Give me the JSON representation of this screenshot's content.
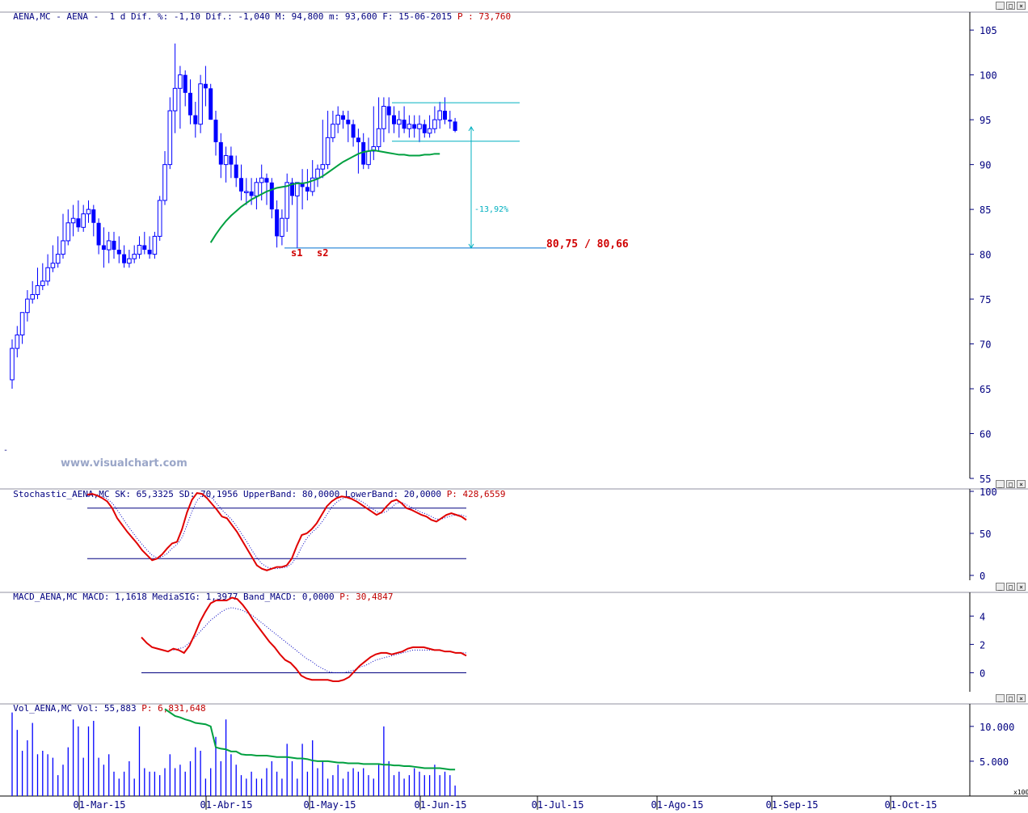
{
  "price_panel": {
    "header_symbol": "AENA,MC - AENA -  1 d Dif. %: -1,10 Dif.: -1,040 M: 94,800 m: 93,600 F: 15-06-2015",
    "header_p_label": "P : 73,760",
    "watermark": "www.visualchart.com",
    "support_label": "80,75 / 80,66",
    "s1_label": "s1",
    "s2_label": "s2",
    "pct_label": "-13,92%"
  },
  "stoch_panel": {
    "header": "Stochastic_AENA,MC SK: 65,3325 SD: 70,1956 UpperBand: 80,0000 LowerBand: 20,0000",
    "header_p": "P: 428,6559"
  },
  "macd_panel": {
    "header": "MACD_AENA,MC MACD: 1,1618 MediaSIG: 1,3977 Band_MACD: 0,0000",
    "header_p": "P: 30,4847"
  },
  "vol_panel": {
    "header": "Vol_AENA,MC Vol: 55,883",
    "header_p": "P: 6,831,648",
    "multiplier": "x100"
  },
  "colors": {
    "candle": "#0000ff",
    "ma": "#00a040",
    "osc_main": "#e00000",
    "osc_signal": "#0000c0",
    "band": "#000080",
    "annot": "#00b0c0",
    "support": "#0070d0",
    "label_red": "#d00000"
  },
  "chart_data": [
    {
      "type": "candlestick",
      "title": "AENA,MC - AENA - 1 d",
      "x": [
        "11-Feb-15",
        "12-Feb-15",
        "13-Feb-15",
        "16-Feb-15",
        "17-Feb-15",
        "18-Feb-15",
        "19-Feb-15",
        "20-Feb-15",
        "23-Feb-15",
        "24-Feb-15",
        "25-Feb-15",
        "26-Feb-15",
        "27-Feb-15",
        "02-Mar-15",
        "03-Mar-15",
        "04-Mar-15",
        "05-Mar-15",
        "06-Mar-15",
        "09-Mar-15",
        "10-Mar-15",
        "11-Mar-15",
        "12-Mar-15",
        "13-Mar-15",
        "16-Mar-15",
        "17-Mar-15",
        "18-Mar-15",
        "19-Mar-15",
        "20-Mar-15",
        "23-Mar-15",
        "24-Mar-15",
        "25-Mar-15",
        "26-Mar-15",
        "27-Mar-15",
        "30-Mar-15",
        "31-Mar-15",
        "01-Apr-15",
        "02-Apr-15",
        "06-Apr-15",
        "07-Apr-15",
        "08-Apr-15",
        "09-Apr-15",
        "10-Apr-15",
        "13-Apr-15",
        "14-Apr-15",
        "15-Apr-15",
        "16-Apr-15",
        "17-Apr-15",
        "20-Apr-15",
        "21-Apr-15",
        "22-Apr-15",
        "23-Apr-15",
        "24-Apr-15",
        "27-Apr-15",
        "28-Apr-15",
        "29-Apr-15",
        "30-Apr-15",
        "01-May-15",
        "04-May-15",
        "05-May-15",
        "06-May-15",
        "07-May-15",
        "08-May-15",
        "11-May-15",
        "12-May-15",
        "13-May-15",
        "14-May-15",
        "15-May-15",
        "18-May-15",
        "19-May-15",
        "20-May-15",
        "21-May-15",
        "22-May-15",
        "25-May-15",
        "26-May-15",
        "27-May-15",
        "28-May-15",
        "29-May-15",
        "01-Jun-15",
        "02-Jun-15",
        "03-Jun-15",
        "04-Jun-15",
        "05-Jun-15",
        "08-Jun-15",
        "09-Jun-15",
        "10-Jun-15",
        "11-Jun-15",
        "12-Jun-15",
        "15-Jun-15"
      ],
      "open": [
        66.0,
        69.5,
        71.0,
        73.5,
        75.0,
        75.5,
        76.5,
        77.0,
        78.5,
        79.0,
        80.0,
        81.5,
        83.5,
        84.0,
        83.0,
        84.5,
        85.0,
        83.5,
        81.0,
        80.5,
        81.5,
        80.5,
        80.0,
        79.0,
        79.5,
        80.0,
        81.0,
        80.5,
        80.0,
        82.0,
        86.0,
        90.0,
        96.0,
        98.5,
        100.0,
        98.0,
        95.5,
        94.5,
        99.0,
        98.5,
        95.0,
        92.5,
        90.0,
        91.0,
        90.0,
        88.5,
        87.0,
        87.0,
        86.5,
        88.0,
        88.5,
        88.0,
        85.0,
        82.0,
        84.0,
        88.0,
        86.5,
        88.0,
        87.5,
        87.0,
        88.5,
        89.5,
        90.0,
        93.0,
        94.5,
        95.5,
        95.0,
        94.5,
        93.0,
        92.5,
        90.0,
        91.5,
        92.0,
        94.0,
        96.5,
        95.5,
        94.5,
        95.0,
        94.0,
        94.5,
        94.0,
        94.5,
        93.5,
        94.0,
        95.0,
        96.0,
        95.0,
        94.8
      ],
      "high": [
        70.5,
        72.0,
        73.5,
        76.0,
        77.0,
        78.5,
        79.0,
        80.0,
        81.0,
        82.0,
        84.5,
        85.0,
        85.5,
        86.0,
        85.5,
        86.0,
        85.5,
        84.0,
        83.0,
        82.5,
        82.5,
        82.0,
        81.0,
        80.5,
        81.0,
        82.0,
        82.5,
        82.0,
        82.5,
        86.5,
        91.5,
        97.5,
        103.5,
        101.0,
        100.5,
        99.5,
        97.0,
        100.0,
        101.0,
        99.0,
        96.0,
        93.5,
        92.0,
        92.0,
        91.0,
        90.0,
        88.5,
        88.5,
        88.5,
        90.0,
        89.0,
        88.5,
        86.0,
        85.0,
        89.0,
        88.5,
        88.0,
        89.5,
        89.5,
        90.5,
        90.0,
        95.0,
        96.0,
        96.0,
        96.5,
        96.0,
        96.0,
        95.0,
        94.0,
        93.5,
        93.0,
        96.5,
        97.5,
        97.5,
        97.5,
        96.5,
        96.0,
        96.5,
        95.5,
        95.5,
        95.5,
        95.0,
        95.5,
        96.5,
        97.0,
        97.5,
        96.0,
        95.2
      ],
      "low": [
        65.0,
        68.5,
        70.0,
        72.5,
        74.5,
        75.0,
        76.0,
        76.5,
        78.0,
        78.5,
        79.5,
        81.0,
        82.0,
        82.5,
        82.5,
        83.5,
        82.0,
        80.0,
        78.5,
        79.0,
        79.5,
        79.0,
        78.5,
        78.5,
        79.0,
        79.5,
        80.0,
        79.5,
        79.5,
        81.5,
        85.5,
        89.5,
        93.5,
        94.0,
        96.5,
        94.5,
        93.0,
        93.5,
        96.5,
        95.0,
        91.0,
        88.5,
        88.0,
        88.5,
        87.5,
        86.0,
        85.5,
        85.5,
        85.0,
        86.0,
        85.5,
        84.0,
        80.75,
        81.0,
        82.5,
        85.5,
        80.66,
        85.0,
        86.0,
        86.5,
        87.5,
        88.5,
        89.5,
        92.5,
        93.5,
        94.0,
        92.5,
        92.0,
        89.0,
        89.5,
        89.5,
        90.5,
        91.5,
        92.5,
        93.5,
        93.5,
        93.0,
        93.5,
        93.0,
        93.0,
        92.5,
        93.0,
        93.0,
        93.5,
        94.0,
        94.5,
        94.0,
        93.6
      ],
      "close": [
        69.5,
        71.0,
        73.5,
        75.0,
        75.5,
        76.5,
        77.0,
        78.5,
        79.0,
        80.0,
        81.5,
        83.5,
        84.0,
        83.0,
        84.5,
        85.0,
        83.5,
        81.0,
        80.5,
        81.5,
        80.5,
        80.0,
        79.0,
        79.5,
        80.0,
        81.0,
        80.5,
        80.0,
        82.0,
        86.0,
        90.0,
        96.0,
        98.5,
        100.0,
        98.0,
        95.5,
        94.5,
        99.0,
        98.5,
        95.0,
        92.5,
        90.0,
        91.0,
        90.0,
        88.5,
        87.0,
        87.0,
        86.5,
        88.0,
        88.5,
        88.0,
        85.0,
        82.0,
        84.0,
        88.0,
        86.5,
        88.0,
        87.5,
        87.0,
        88.5,
        89.5,
        90.0,
        93.0,
        94.5,
        95.5,
        95.0,
        94.5,
        93.0,
        92.5,
        90.0,
        91.5,
        92.0,
        94.0,
        96.5,
        95.5,
        94.5,
        95.0,
        94.0,
        94.5,
        94.0,
        94.5,
        93.5,
        94.0,
        95.0,
        96.0,
        95.0,
        94.8,
        93.76
      ],
      "ma": [
        null,
        null,
        null,
        null,
        null,
        null,
        null,
        null,
        null,
        null,
        null,
        null,
        null,
        null,
        null,
        null,
        null,
        null,
        null,
        null,
        null,
        null,
        null,
        null,
        null,
        null,
        null,
        null,
        null,
        null,
        null,
        null,
        null,
        null,
        null,
        null,
        null,
        null,
        null,
        81.3,
        82.2,
        83.0,
        83.7,
        84.3,
        84.8,
        85.3,
        85.7,
        86.1,
        86.4,
        86.7,
        87.0,
        87.2,
        87.4,
        87.5,
        87.6,
        87.8,
        87.9,
        87.9,
        88.0,
        88.2,
        88.4,
        88.7,
        89.1,
        89.5,
        89.9,
        90.3,
        90.6,
        90.9,
        91.2,
        91.4,
        91.5,
        91.6,
        91.5,
        91.4,
        91.3,
        91.2,
        91.1,
        91.1,
        91.0,
        91.0,
        91.0,
        91.1,
        91.1,
        91.2,
        91.2
      ],
      "ylim": [
        55,
        107
      ],
      "yticks": [
        55,
        60,
        65,
        70,
        75,
        80,
        85,
        90,
        95,
        100,
        105
      ],
      "xtick_labels": [
        "01-Mar-15",
        "01-Abr-15",
        "01-May-15",
        "01-Jun-15",
        "01-Jul-15",
        "01-Ago-15",
        "01-Sep-15",
        "01-Oct-15"
      ],
      "annotations": {
        "range_top": 96.9,
        "range_bottom": 92.6,
        "support": 80.7,
        "arrow_from": 94.2,
        "arrow_to": 80.7,
        "pct": "-13,92%"
      }
    },
    {
      "type": "line",
      "title": "Stochastic_AENA,MC",
      "sk": [
        96,
        97,
        95,
        92,
        88,
        80,
        68,
        60,
        52,
        45,
        38,
        30,
        24,
        18,
        20,
        25,
        32,
        38,
        40,
        55,
        75,
        90,
        98,
        97,
        92,
        85,
        78,
        70,
        68,
        60,
        52,
        42,
        32,
        22,
        12,
        8,
        6,
        8,
        10,
        10,
        12,
        20,
        35,
        48,
        50,
        55,
        62,
        72,
        82,
        88,
        92,
        94,
        93,
        91,
        88,
        84,
        80,
        76,
        72,
        75,
        82,
        88,
        90,
        86,
        80,
        78,
        75,
        72,
        70,
        66,
        64,
        68,
        72,
        74,
        72,
        70,
        66
      ],
      "sd": [
        95,
        96,
        96,
        94,
        91,
        86,
        78,
        69,
        60,
        52,
        44,
        37,
        30,
        24,
        21,
        22,
        26,
        32,
        37,
        45,
        60,
        76,
        89,
        95,
        95,
        92,
        85,
        78,
        72,
        66,
        58,
        49,
        40,
        30,
        21,
        14,
        10,
        8,
        8,
        9,
        10,
        14,
        22,
        34,
        44,
        51,
        56,
        63,
        72,
        81,
        87,
        91,
        93,
        93,
        91,
        88,
        84,
        80,
        76,
        74,
        76,
        81,
        86,
        87,
        84,
        81,
        78,
        75,
        73,
        70,
        67,
        67,
        69,
        71,
        72,
        72,
        70
      ],
      "upper_band": 80,
      "lower_band": 20,
      "yticks": [
        0,
        50,
        100
      ],
      "ylim": [
        0,
        100
      ]
    },
    {
      "type": "line",
      "title": "MACD_AENA,MC",
      "macd": [
        2.5,
        2.1,
        1.8,
        1.7,
        1.6,
        1.5,
        1.7,
        1.6,
        1.4,
        1.9,
        2.7,
        3.6,
        4.3,
        4.9,
        5.1,
        5.1,
        5.1,
        5.3,
        5.2,
        4.8,
        4.3,
        3.7,
        3.2,
        2.7,
        2.2,
        1.8,
        1.3,
        0.9,
        0.7,
        0.3,
        -0.2,
        -0.4,
        -0.5,
        -0.5,
        -0.5,
        -0.5,
        -0.6,
        -0.6,
        -0.5,
        -0.3,
        0.1,
        0.5,
        0.8,
        1.1,
        1.3,
        1.4,
        1.4,
        1.3,
        1.4,
        1.5,
        1.7,
        1.8,
        1.8,
        1.8,
        1.7,
        1.6,
        1.6,
        1.5,
        1.5,
        1.4,
        1.4,
        1.2
      ],
      "signal": [
        null,
        null,
        null,
        null,
        null,
        null,
        1.6,
        1.7,
        1.8,
        2.1,
        2.5,
        2.9,
        3.3,
        3.7,
        4.0,
        4.3,
        4.5,
        4.6,
        4.5,
        4.4,
        4.2,
        4.0,
        3.7,
        3.4,
        3.1,
        2.8,
        2.5,
        2.2,
        1.9,
        1.6,
        1.3,
        1.0,
        0.8,
        0.5,
        0.3,
        0.1,
        0.0,
        0.0,
        0.0,
        0.1,
        0.2,
        0.4,
        0.5,
        0.7,
        0.9,
        1.0,
        1.1,
        1.2,
        1.3,
        1.4,
        1.5,
        1.6,
        1.6,
        1.6,
        1.6,
        1.6,
        1.6,
        1.5,
        1.5,
        1.4,
        1.4,
        1.4
      ],
      "band": 0,
      "yticks": [
        0,
        2,
        4
      ],
      "ylim": [
        -1,
        5.5
      ]
    },
    {
      "type": "bar",
      "title": "Vol_AENA,MC",
      "values": [
        12000,
        9500,
        6500,
        8000,
        10500,
        6000,
        6500,
        6000,
        5500,
        3000,
        4500,
        7000,
        11000,
        10000,
        5500,
        10000,
        10800,
        5500,
        4500,
        6000,
        3500,
        2500,
        3500,
        5000,
        2500,
        10000,
        4000,
        3500,
        3500,
        3000,
        4000,
        6000,
        4000,
        4500,
        3500,
        5000,
        7000,
        6500,
        2500,
        4000,
        8500,
        5000,
        11000,
        6000,
        4500,
        3000,
        2500,
        3500,
        2500,
        2500,
        4000,
        5000,
        3500,
        2500,
        7500,
        5000,
        2500,
        7500,
        3500,
        8000,
        4000,
        5000,
        2500,
        3000,
        4500,
        2500,
        3500,
        4000,
        3500,
        4000,
        3000,
        2500,
        4500,
        10000,
        5000,
        3000,
        3500,
        2500,
        3000,
        4000,
        3500,
        3000,
        3000,
        4500,
        3000,
        3500,
        3000,
        1500
      ],
      "average": [
        null,
        null,
        null,
        null,
        null,
        null,
        null,
        null,
        null,
        null,
        null,
        null,
        null,
        null,
        null,
        null,
        null,
        null,
        null,
        null,
        null,
        null,
        null,
        null,
        null,
        null,
        null,
        null,
        null,
        null,
        12500,
        12000,
        11500,
        11300,
        11000,
        10800,
        10500,
        10400,
        10300,
        10000,
        7000,
        6800,
        6700,
        6400,
        6400,
        6000,
        5900,
        5900,
        5800,
        5800,
        5800,
        5700,
        5600,
        5600,
        5600,
        5500,
        5400,
        5400,
        5300,
        5100,
        5000,
        5000,
        5000,
        4900,
        4800,
        4800,
        4700,
        4700,
        4700,
        4600,
        4600,
        4600,
        4600,
        4500,
        4500,
        4400,
        4400,
        4300,
        4300,
        4200,
        4100,
        4000,
        4000,
        4000,
        4000,
        3900,
        3800,
        3800
      ],
      "yticks": [
        5000,
        10000
      ],
      "ytick_labels": [
        "5.000",
        "10.000"
      ],
      "ylim": [
        0,
        13000
      ]
    }
  ]
}
